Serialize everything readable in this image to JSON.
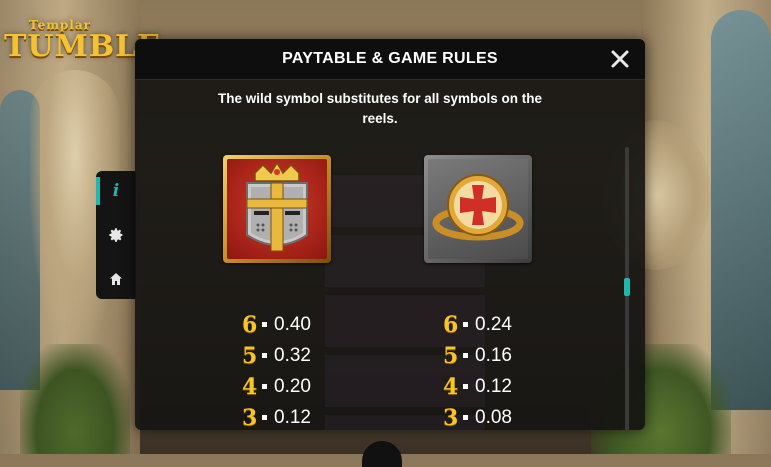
{
  "game": {
    "logo_top": "Templar",
    "logo_main": "TUMBLE"
  },
  "side_menu": {
    "items": [
      {
        "icon": "info-icon",
        "glyph": "i",
        "active": true
      },
      {
        "icon": "gear-icon",
        "active": false
      },
      {
        "icon": "home-icon",
        "active": false
      }
    ]
  },
  "dialog": {
    "title": "PAYTABLE & GAME RULES",
    "close_glyph": "✕",
    "rules_text": "The wild symbol substitutes for all symbols on the reels.",
    "accent_color": "#1fb7b2",
    "scroll_position": 0.47
  },
  "paytable": [
    {
      "symbol": "crusader-helmet",
      "payouts": [
        {
          "count": "6",
          "value": "0.40"
        },
        {
          "count": "5",
          "value": "0.32"
        },
        {
          "count": "4",
          "value": "0.20"
        },
        {
          "count": "3",
          "value": "0.12"
        }
      ]
    },
    {
      "symbol": "templar-ring",
      "payouts": [
        {
          "count": "6",
          "value": "0.24"
        },
        {
          "count": "5",
          "value": "0.16"
        },
        {
          "count": "4",
          "value": "0.12"
        },
        {
          "count": "3",
          "value": "0.08"
        }
      ]
    }
  ]
}
